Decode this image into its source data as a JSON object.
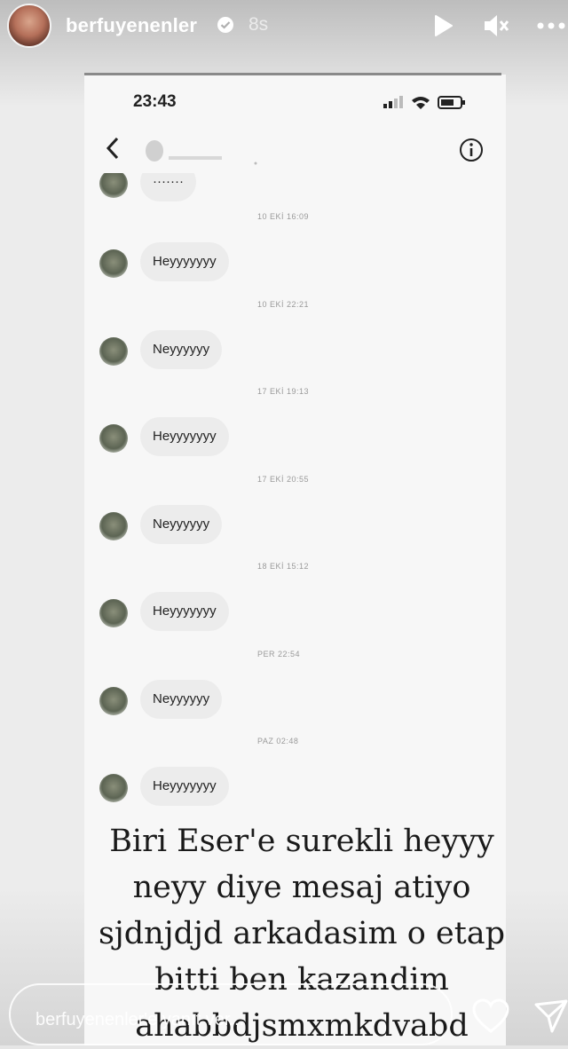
{
  "story": {
    "username": "berfuyenenler",
    "time_ago": "8s",
    "icons": {
      "verified": "verified-badge-icon",
      "play": "play-icon",
      "mute": "mute-icon",
      "more": "more-icon"
    }
  },
  "screenshot": {
    "status_time": "23:43",
    "contact_name": "",
    "messages": [
      {
        "time": "",
        "text": "·······"
      },
      {
        "time": "10 EKİ 16:09",
        "text": "Heyyyyyyy"
      },
      {
        "time": "10 EKİ 22:21",
        "text": "Neyyyyyy"
      },
      {
        "time": "17 EKİ 19:13",
        "text": "Heyyyyyyy"
      },
      {
        "time": "17 EKİ 20:55",
        "text": "Neyyyyyy"
      },
      {
        "time": "18 EKİ 15:12",
        "text": "Heyyyyyyy"
      },
      {
        "time": "PER 22:54",
        "text": "Neyyyyyy"
      },
      {
        "time": "PAZ 02:48",
        "text": "Heyyyyyyy"
      }
    ]
  },
  "caption": {
    "lines": [
      "Biri Eser'e surekli heyyy",
      "neyy diye mesaj atiyo",
      "sjdnjdjd arkadasim o etap",
      "bitti ben kazandim",
      "ahabbdjsmxmkdvabd"
    ]
  },
  "reply_bar": {
    "placeholder": "berfuyenenler'e yanıt ver..."
  },
  "colors": {
    "story_text": "#ffffff",
    "bubble": "#ececec",
    "timestamp": "#9a9a9a"
  }
}
